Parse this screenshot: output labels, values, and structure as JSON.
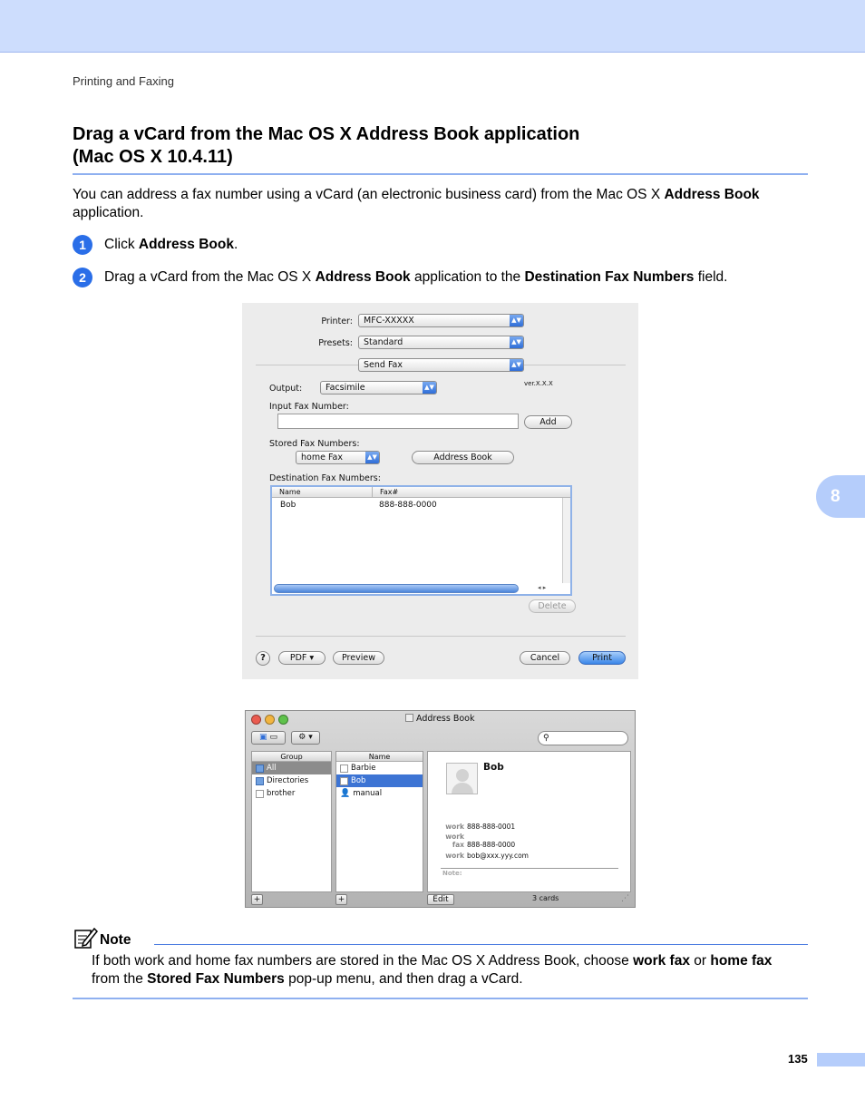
{
  "header": {
    "running_head": "Printing and Faxing"
  },
  "section": {
    "title_line1": "Drag a vCard from the Mac OS X Address Book application",
    "title_line2": "(Mac OS X 10.4.11)"
  },
  "intro": {
    "pre": "You can address a fax number using a vCard (an electronic business card) from the Mac OS X ",
    "bold": "Address Book",
    "post": " application."
  },
  "steps": [
    {
      "num": "1",
      "pre": "Click ",
      "bold": "Address Book",
      "post": "."
    },
    {
      "num": "2",
      "pre": "Drag a vCard from the Mac OS X ",
      "bold": "Address Book",
      "mid": " application to the ",
      "bold2": "Destination Fax Numbers",
      "post": " field."
    }
  ],
  "chapter_tab": "8",
  "print_dialog": {
    "printer_label": "Printer:",
    "printer_value": "MFC-XXXXX",
    "presets_label": "Presets:",
    "presets_value": "Standard",
    "pane_value": "Send Fax",
    "output_label": "Output:",
    "output_value": "Facsimile",
    "version": "ver.X.X.X",
    "input_fax_label": "Input Fax Number:",
    "add_button": "Add",
    "stored_label": "Stored Fax Numbers:",
    "stored_value": "home Fax",
    "address_book_button": "Address Book",
    "destination_label": "Destination Fax Numbers:",
    "table": {
      "columns": [
        "Name",
        "Fax#"
      ],
      "rows": [
        {
          "name": "Bob",
          "fax": "888-888-0000"
        }
      ]
    },
    "delete_button": "Delete",
    "help_button": "?",
    "pdf_button": "PDF ▾",
    "preview_button": "Preview",
    "cancel_button": "Cancel",
    "print_button": "Print"
  },
  "address_book": {
    "window_title": "Address Book",
    "group_header": "Group",
    "groups": [
      "All",
      "Directories",
      "brother"
    ],
    "name_header": "Name",
    "names": [
      "Barbie",
      "Bob",
      "manual"
    ],
    "card": {
      "name": "Bob",
      "fields": [
        {
          "label": "work",
          "value": "888-888-0001"
        },
        {
          "label": "work fax",
          "value": "888-888-0000"
        },
        {
          "label": "work",
          "value": "bob@xxx.yyy.com"
        }
      ],
      "note_label": "Note:"
    },
    "edit_button": "Edit",
    "card_count": "3 cards",
    "plus": "+"
  },
  "note": {
    "label": "Note",
    "pre": "If both work and home fax numbers are stored in the Mac OS X Address Book, choose ",
    "bold1": "work fax",
    "mid1": " or ",
    "bold2": "home fax",
    "mid2": " from the ",
    "bold3": "Stored Fax Numbers",
    "post": " pop-up menu, and then drag a vCard."
  },
  "footer": {
    "page_number": "135"
  }
}
